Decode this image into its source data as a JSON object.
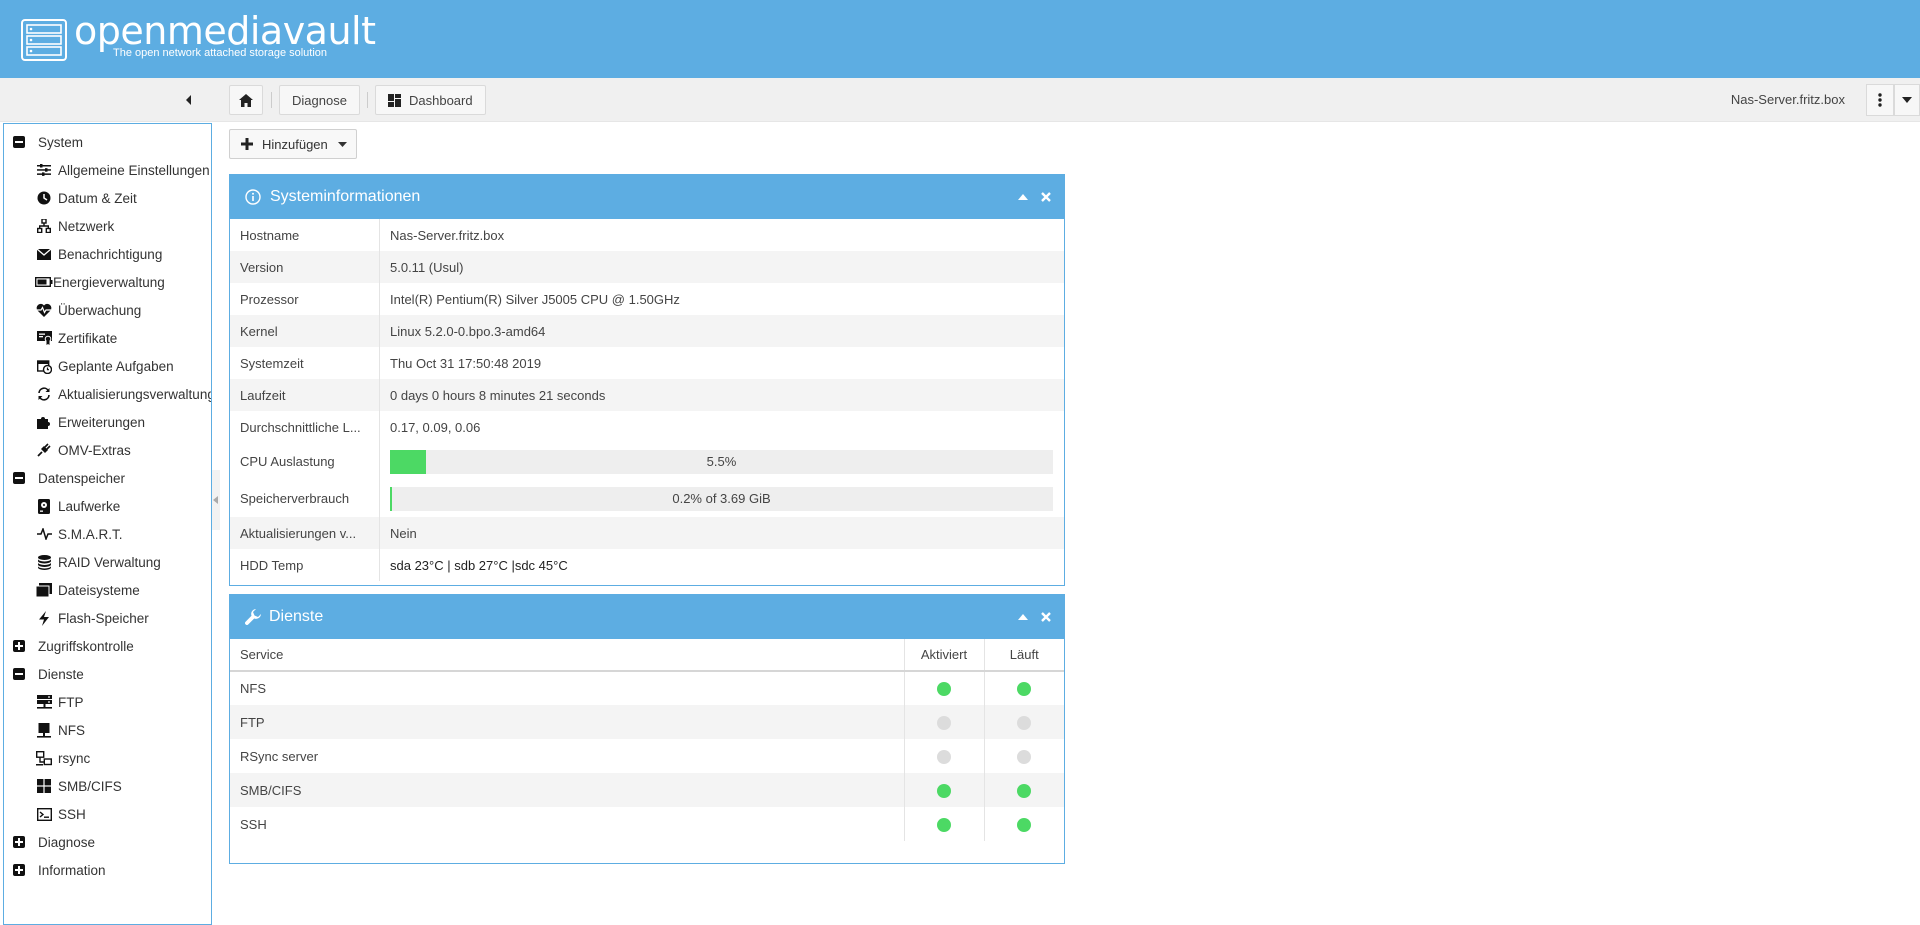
{
  "header": {
    "logo_text": "openmediavault",
    "logo_subtitle": "The open network attached storage solution"
  },
  "toolbar": {
    "breadcrumbs": [
      {
        "label": "",
        "icon": "home-icon"
      },
      {
        "label": "Diagnose"
      },
      {
        "label": "Dashboard",
        "icon": "dashboard-icon"
      }
    ],
    "hostname": "Nas-Server.fritz.box"
  },
  "sidebar": {
    "groups": [
      {
        "label": "System",
        "expanded": true,
        "items": [
          {
            "label": "Allgemeine Einstellungen",
            "icon": "sliders-icon"
          },
          {
            "label": "Datum & Zeit",
            "icon": "clock-icon"
          },
          {
            "label": "Netzwerk",
            "icon": "network-icon"
          },
          {
            "label": "Benachrichtigung",
            "icon": "envelope-icon"
          },
          {
            "label": "Energieverwaltung",
            "icon": "battery-icon"
          },
          {
            "label": "Überwachung",
            "icon": "heartbeat-icon"
          },
          {
            "label": "Zertifikate",
            "icon": "certificate-icon"
          },
          {
            "label": "Geplante Aufgaben",
            "icon": "calendar-clock-icon"
          },
          {
            "label": "Aktualisierungsverwaltung",
            "icon": "refresh-icon"
          },
          {
            "label": "Erweiterungen",
            "icon": "puzzle-icon"
          },
          {
            "label": "OMV-Extras",
            "icon": "plug-icon"
          }
        ]
      },
      {
        "label": "Datenspeicher",
        "expanded": true,
        "items": [
          {
            "label": "Laufwerke",
            "icon": "disk-icon"
          },
          {
            "label": "S.M.A.R.T.",
            "icon": "pulse-icon"
          },
          {
            "label": "RAID Verwaltung",
            "icon": "database-icon"
          },
          {
            "label": "Dateisysteme",
            "icon": "folders-icon"
          },
          {
            "label": "Flash-Speicher",
            "icon": "bolt-icon"
          }
        ]
      },
      {
        "label": "Zugriffskontrolle",
        "expanded": false,
        "items": []
      },
      {
        "label": "Dienste",
        "expanded": true,
        "items": [
          {
            "label": "FTP",
            "icon": "server-icon"
          },
          {
            "label": "NFS",
            "icon": "monitor-icon"
          },
          {
            "label": "rsync",
            "icon": "sync-computers-icon"
          },
          {
            "label": "SMB/CIFS",
            "icon": "windows-icon"
          },
          {
            "label": "SSH",
            "icon": "terminal-icon"
          }
        ]
      },
      {
        "label": "Diagnose",
        "expanded": false,
        "items": []
      },
      {
        "label": "Information",
        "expanded": false,
        "items": []
      }
    ]
  },
  "add_button": {
    "label": "Hinzufügen"
  },
  "sysinfo": {
    "title": "Systeminformationen",
    "rows": [
      {
        "key": "Hostname",
        "value": "Nas-Server.fritz.box"
      },
      {
        "key": "Version",
        "value": "5.0.11 (Usul)"
      },
      {
        "key": "Prozessor",
        "value": "Intel(R) Pentium(R) Silver J5005 CPU @ 1.50GHz"
      },
      {
        "key": "Kernel",
        "value": "Linux 5.2.0-0.bpo.3-amd64"
      },
      {
        "key": "Systemzeit",
        "value": "Thu Oct 31 17:50:48 2019"
      },
      {
        "key": "Laufzeit",
        "value": "0 days 0 hours 8 minutes 21 seconds"
      },
      {
        "key": "Durchschnittliche L...",
        "value": "0.17, 0.09, 0.06"
      }
    ],
    "cpu": {
      "key": "CPU Auslastung",
      "label": "5.5%",
      "fraction": 0.055
    },
    "memory": {
      "key": "Speicherverbrauch",
      "label": "0.2% of 3.69 GiB",
      "fraction": 0.002
    },
    "rows2": [
      {
        "key": "Aktualisierungen v...",
        "value": "Nein"
      },
      {
        "key": "HDD Temp",
        "value": "sda 23°C | sdb 27°C |sdc 45°C"
      }
    ]
  },
  "services": {
    "title": "Dienste",
    "columns": {
      "service": "Service",
      "enabled": "Aktiviert",
      "running": "Läuft"
    },
    "rows": [
      {
        "name": "NFS",
        "enabled": true,
        "running": true
      },
      {
        "name": "FTP",
        "enabled": false,
        "running": false
      },
      {
        "name": "RSync server",
        "enabled": false,
        "running": false
      },
      {
        "name": "SMB/CIFS",
        "enabled": true,
        "running": true
      },
      {
        "name": "SSH",
        "enabled": true,
        "running": true
      }
    ],
    "color_on": "#4cd964",
    "color_off": "#dcdcdc"
  },
  "colors": {
    "accent": "#5dade2"
  }
}
